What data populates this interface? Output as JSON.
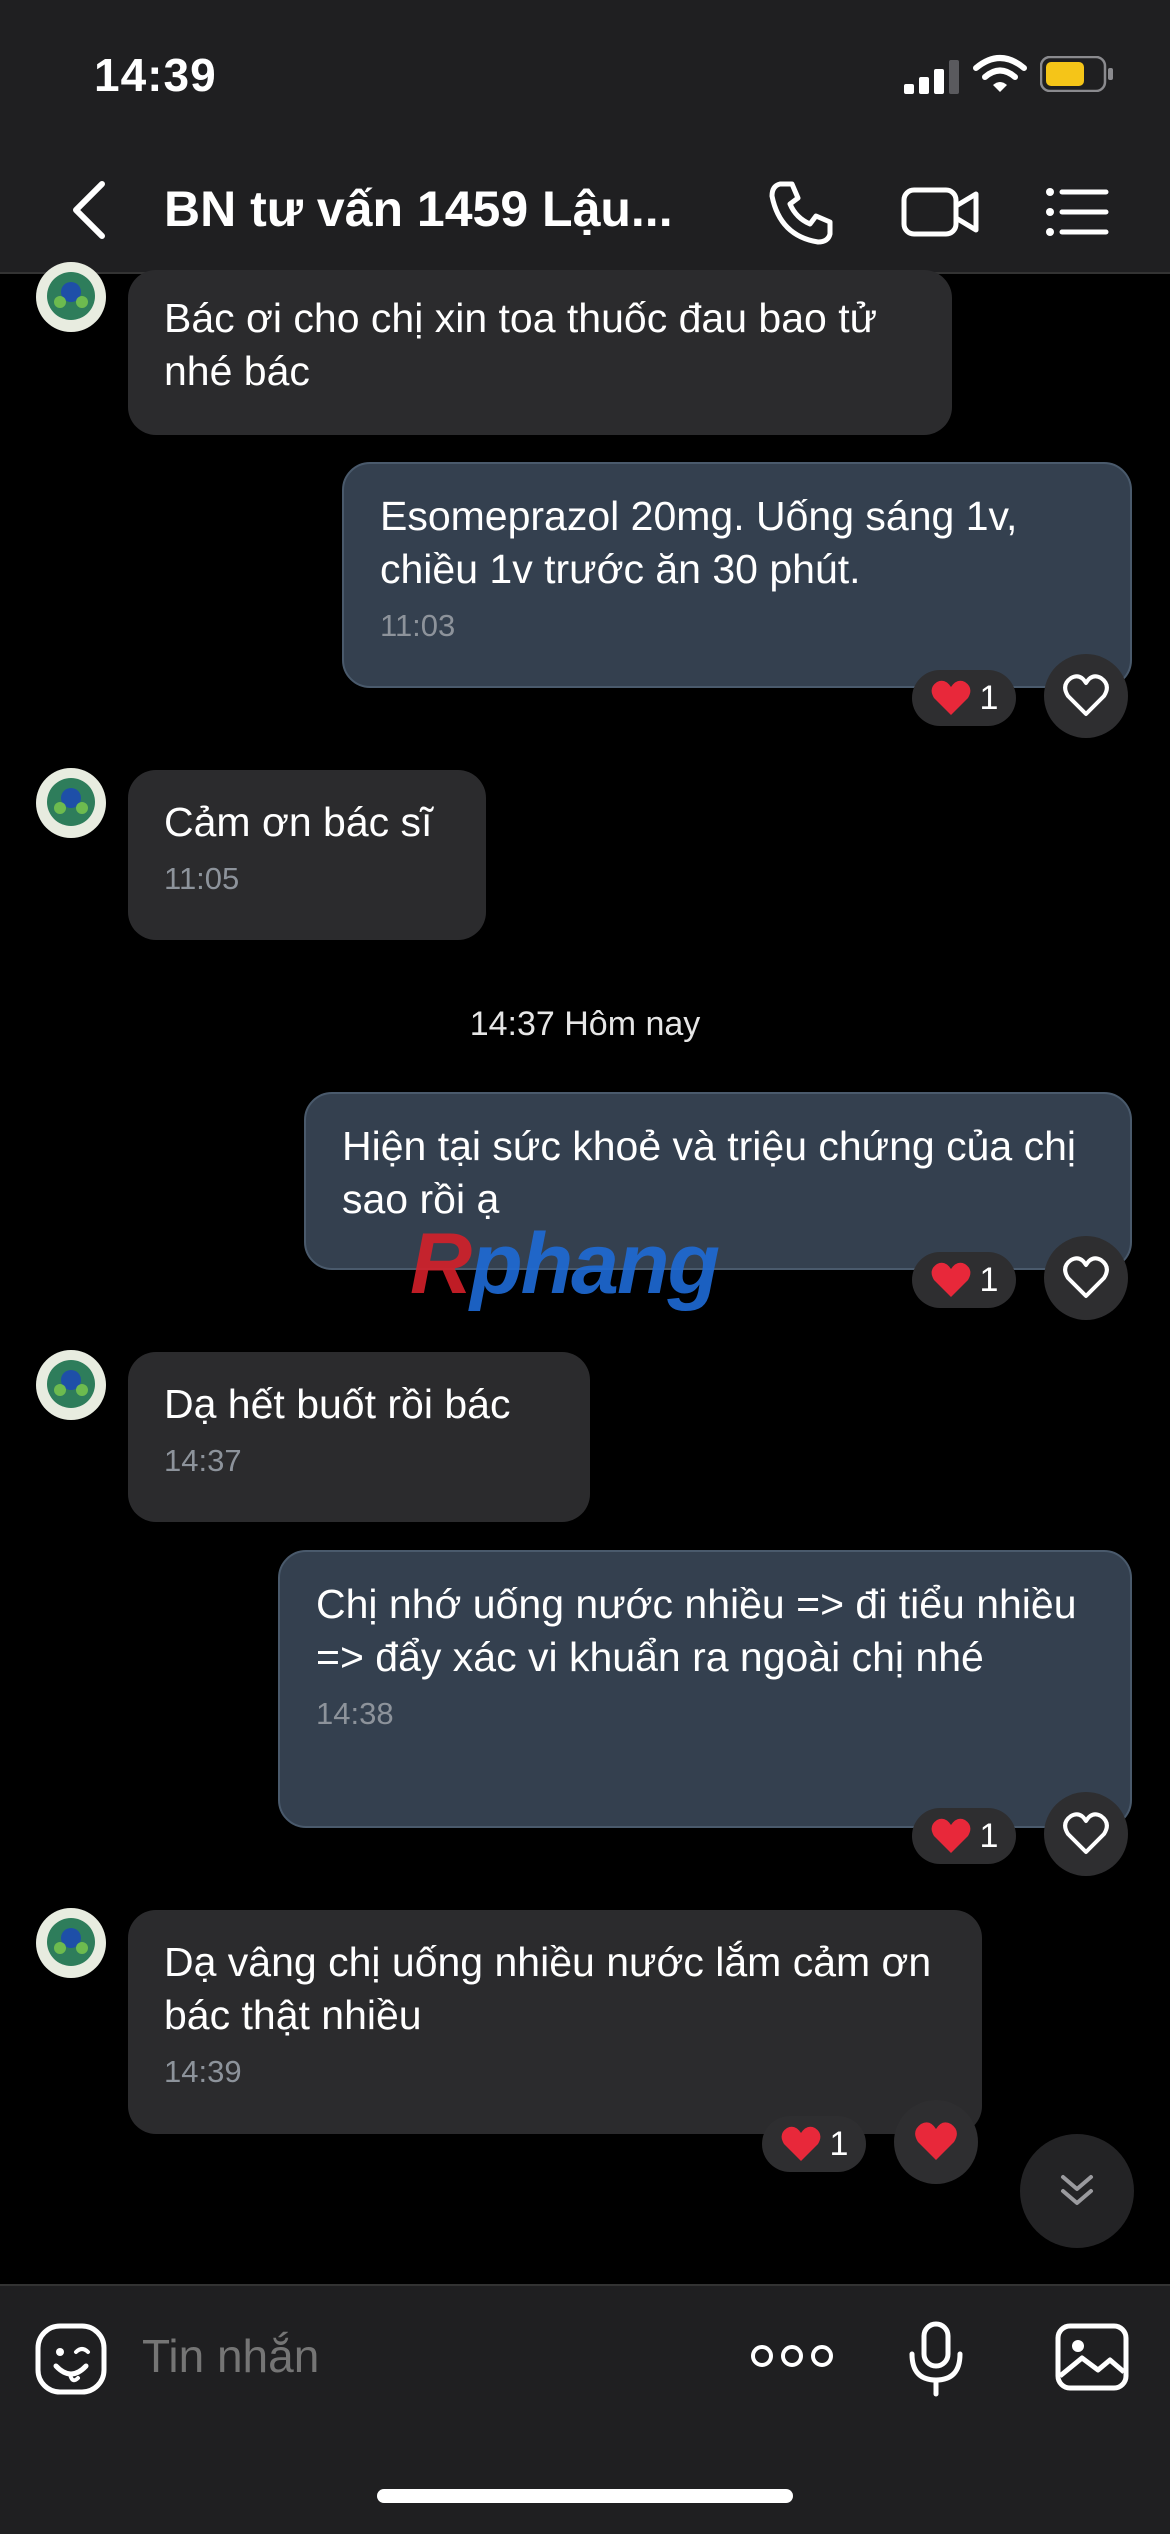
{
  "status_bar": {
    "time": "14:39"
  },
  "header": {
    "title": "BN tư vấn 1459 Lậu..."
  },
  "messages": [
    {
      "text": "Bác ơi cho chị xin toa thuốc đau bao tử nhé bác",
      "time": ""
    },
    {
      "text": "Esomeprazol 20mg. Uống sáng 1v, chiều 1v trước ăn 30 phút.",
      "time": "11:03",
      "reaction_count": "1"
    },
    {
      "text": "Cảm ơn bác sĩ",
      "time": "11:05"
    },
    {
      "text": "Hiện tại sức khoẻ và triệu chứng của chị sao rồi ạ",
      "time": "",
      "reaction_count": "1"
    },
    {
      "text": "Dạ hết buốt rồi bác",
      "time": "14:37"
    },
    {
      "text": "Chị nhớ uống nước nhiều => đi tiểu nhiều => đẩy xác vi khuẩn ra ngoài chị nhé",
      "time": "14:38",
      "reaction_count": "1"
    },
    {
      "text": "Dạ vâng chị uống nhiều nước lắm cảm ơn bác thật nhiều",
      "time": "14:39",
      "reaction_count": "1"
    }
  ],
  "date_divider": "14:37 Hôm nay",
  "watermark": {
    "prefix": "R",
    "rest": "phang"
  },
  "composer": {
    "placeholder": "Tin nhắn"
  },
  "colors": {
    "incoming_bubble": "#2b2b2d",
    "outgoing_bubble": "#34404f",
    "heart": "#e8283a",
    "background": "#000000"
  },
  "icons": [
    "back-icon",
    "phone-icon",
    "video-call-icon",
    "menu-list-icon",
    "heart-icon",
    "heart-outline-icon",
    "chevron-double-down-icon",
    "emoji-icon",
    "more-dots-icon",
    "microphone-icon",
    "image-icon"
  ]
}
